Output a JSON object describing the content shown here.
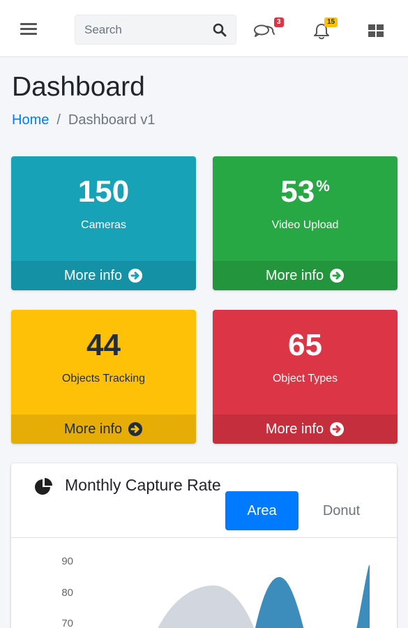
{
  "navbar": {
    "search_placeholder": "Search",
    "messages_badge": "3",
    "notifications_badge": "15"
  },
  "header": {
    "title": "Dashboard",
    "breadcrumb_home": "Home",
    "breadcrumb_separator": "/",
    "breadcrumb_current": "Dashboard v1"
  },
  "boxes": [
    {
      "value": "150",
      "suffix": "",
      "label": "Cameras",
      "footer": "More info",
      "color": "#17a2b8"
    },
    {
      "value": "53",
      "suffix": "%",
      "label": "Video Upload",
      "footer": "More info",
      "color": "#28a745"
    },
    {
      "value": "44",
      "suffix": "",
      "label": "Objects Tracking",
      "footer": "More info",
      "color": "#ffc107"
    },
    {
      "value": "65",
      "suffix": "",
      "label": "Object Types",
      "footer": "More info",
      "color": "#dc3545"
    }
  ],
  "card": {
    "title": "Monthly Capture Rate",
    "tabs": [
      "Area",
      "Donut"
    ],
    "active_tab": "Area"
  },
  "chart_data": {
    "type": "area",
    "y_ticks": [
      "90",
      "80",
      "70"
    ],
    "colors": [
      "#d2d6de",
      "#3c8dbc"
    ]
  }
}
